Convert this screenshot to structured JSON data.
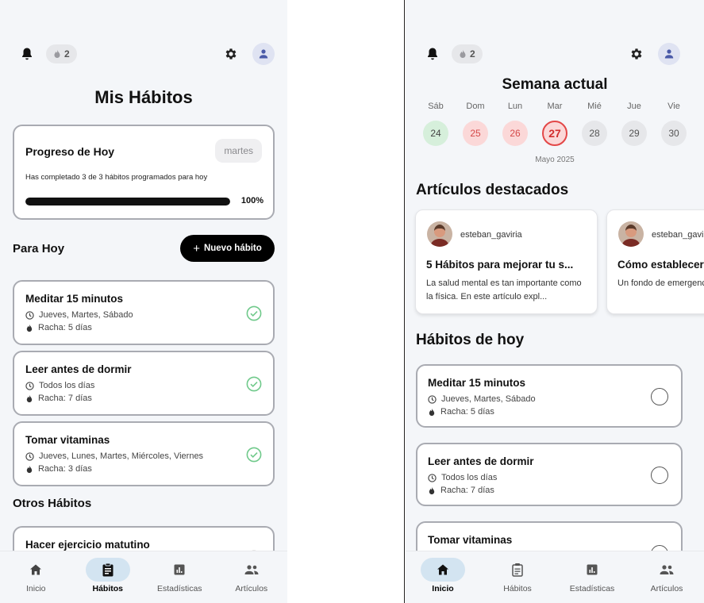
{
  "left": {
    "header": {
      "streak_count": "2"
    },
    "page_title": "Mis Hábitos",
    "progress": {
      "title": "Progreso de Hoy",
      "day": "martes",
      "description": "Has completado 3 de 3 hábitos programados para hoy",
      "percent_label": "100%",
      "percent": 100
    },
    "today_section": {
      "title": "Para Hoy",
      "new_habit_label": "Nuevo hábito"
    },
    "habits": [
      {
        "name": "Meditar 15 minutos",
        "days": "Jueves, Martes, Sábado",
        "streak": "Racha: 5 días",
        "done": true
      },
      {
        "name": "Leer antes de dormir",
        "days": "Todos los días",
        "streak": "Racha: 7 días",
        "done": true
      },
      {
        "name": "Tomar vitaminas",
        "days": "Jueves, Lunes, Martes, Miércoles, Viernes",
        "streak": "Racha: 3 días",
        "done": true
      }
    ],
    "other_section": {
      "title": "Otros Hábitos"
    },
    "other_habit": {
      "name": "Hacer ejercicio matutino"
    },
    "nav": [
      {
        "label": "Inicio",
        "icon": "home-icon",
        "active": false
      },
      {
        "label": "Hábitos",
        "icon": "clipboard-icon",
        "active": true
      },
      {
        "label": "Estadísticas",
        "icon": "chart-icon",
        "active": false
      },
      {
        "label": "Artículos",
        "icon": "people-icon",
        "active": false
      }
    ]
  },
  "right": {
    "header": {
      "streak_count": "2"
    },
    "week": {
      "title": "Semana actual",
      "month": "Mayo 2025",
      "days": [
        {
          "label": "Sáb",
          "num": "24",
          "state": "done"
        },
        {
          "label": "Dom",
          "num": "25",
          "state": "missed"
        },
        {
          "label": "Lun",
          "num": "26",
          "state": "missed"
        },
        {
          "label": "Mar",
          "num": "27",
          "state": "today"
        },
        {
          "label": "Mié",
          "num": "28",
          "state": "future"
        },
        {
          "label": "Jue",
          "num": "29",
          "state": "future"
        },
        {
          "label": "Vie",
          "num": "30",
          "state": "future"
        }
      ]
    },
    "articles_title": "Artículos destacados",
    "articles": [
      {
        "user": "esteban_gaviria",
        "headline": "5 Hábitos para mejorar tu s...",
        "excerpt": "La salud mental es tan importante como la física. En este artículo expl..."
      },
      {
        "user": "esteban_gaviria",
        "headline": "Cómo establecer metas",
        "excerpt": "Un fondo de emergencia es esencial para la estabilidad financiera"
      }
    ],
    "habits_title": "Hábitos de hoy",
    "habits": [
      {
        "name": "Meditar 15 minutos",
        "days": "Jueves, Martes, Sábado",
        "streak": "Racha: 5 días"
      },
      {
        "name": "Leer antes de dormir",
        "days": "Todos los días",
        "streak": "Racha: 7 días"
      },
      {
        "name": "Tomar vitaminas",
        "days": "",
        "streak": ""
      }
    ],
    "nav": [
      {
        "label": "Inicio",
        "icon": "home-icon",
        "active": true
      },
      {
        "label": "Hábitos",
        "icon": "clipboard-icon",
        "active": false
      },
      {
        "label": "Estadísticas",
        "icon": "chart-icon",
        "active": false
      },
      {
        "label": "Artículos",
        "icon": "people-icon",
        "active": false
      }
    ]
  },
  "colors": {
    "accent_dark": "#000000",
    "done_green": "#6fc98a",
    "missed_red": "#e34747",
    "nav_active_bg": "#d3e4f1"
  }
}
